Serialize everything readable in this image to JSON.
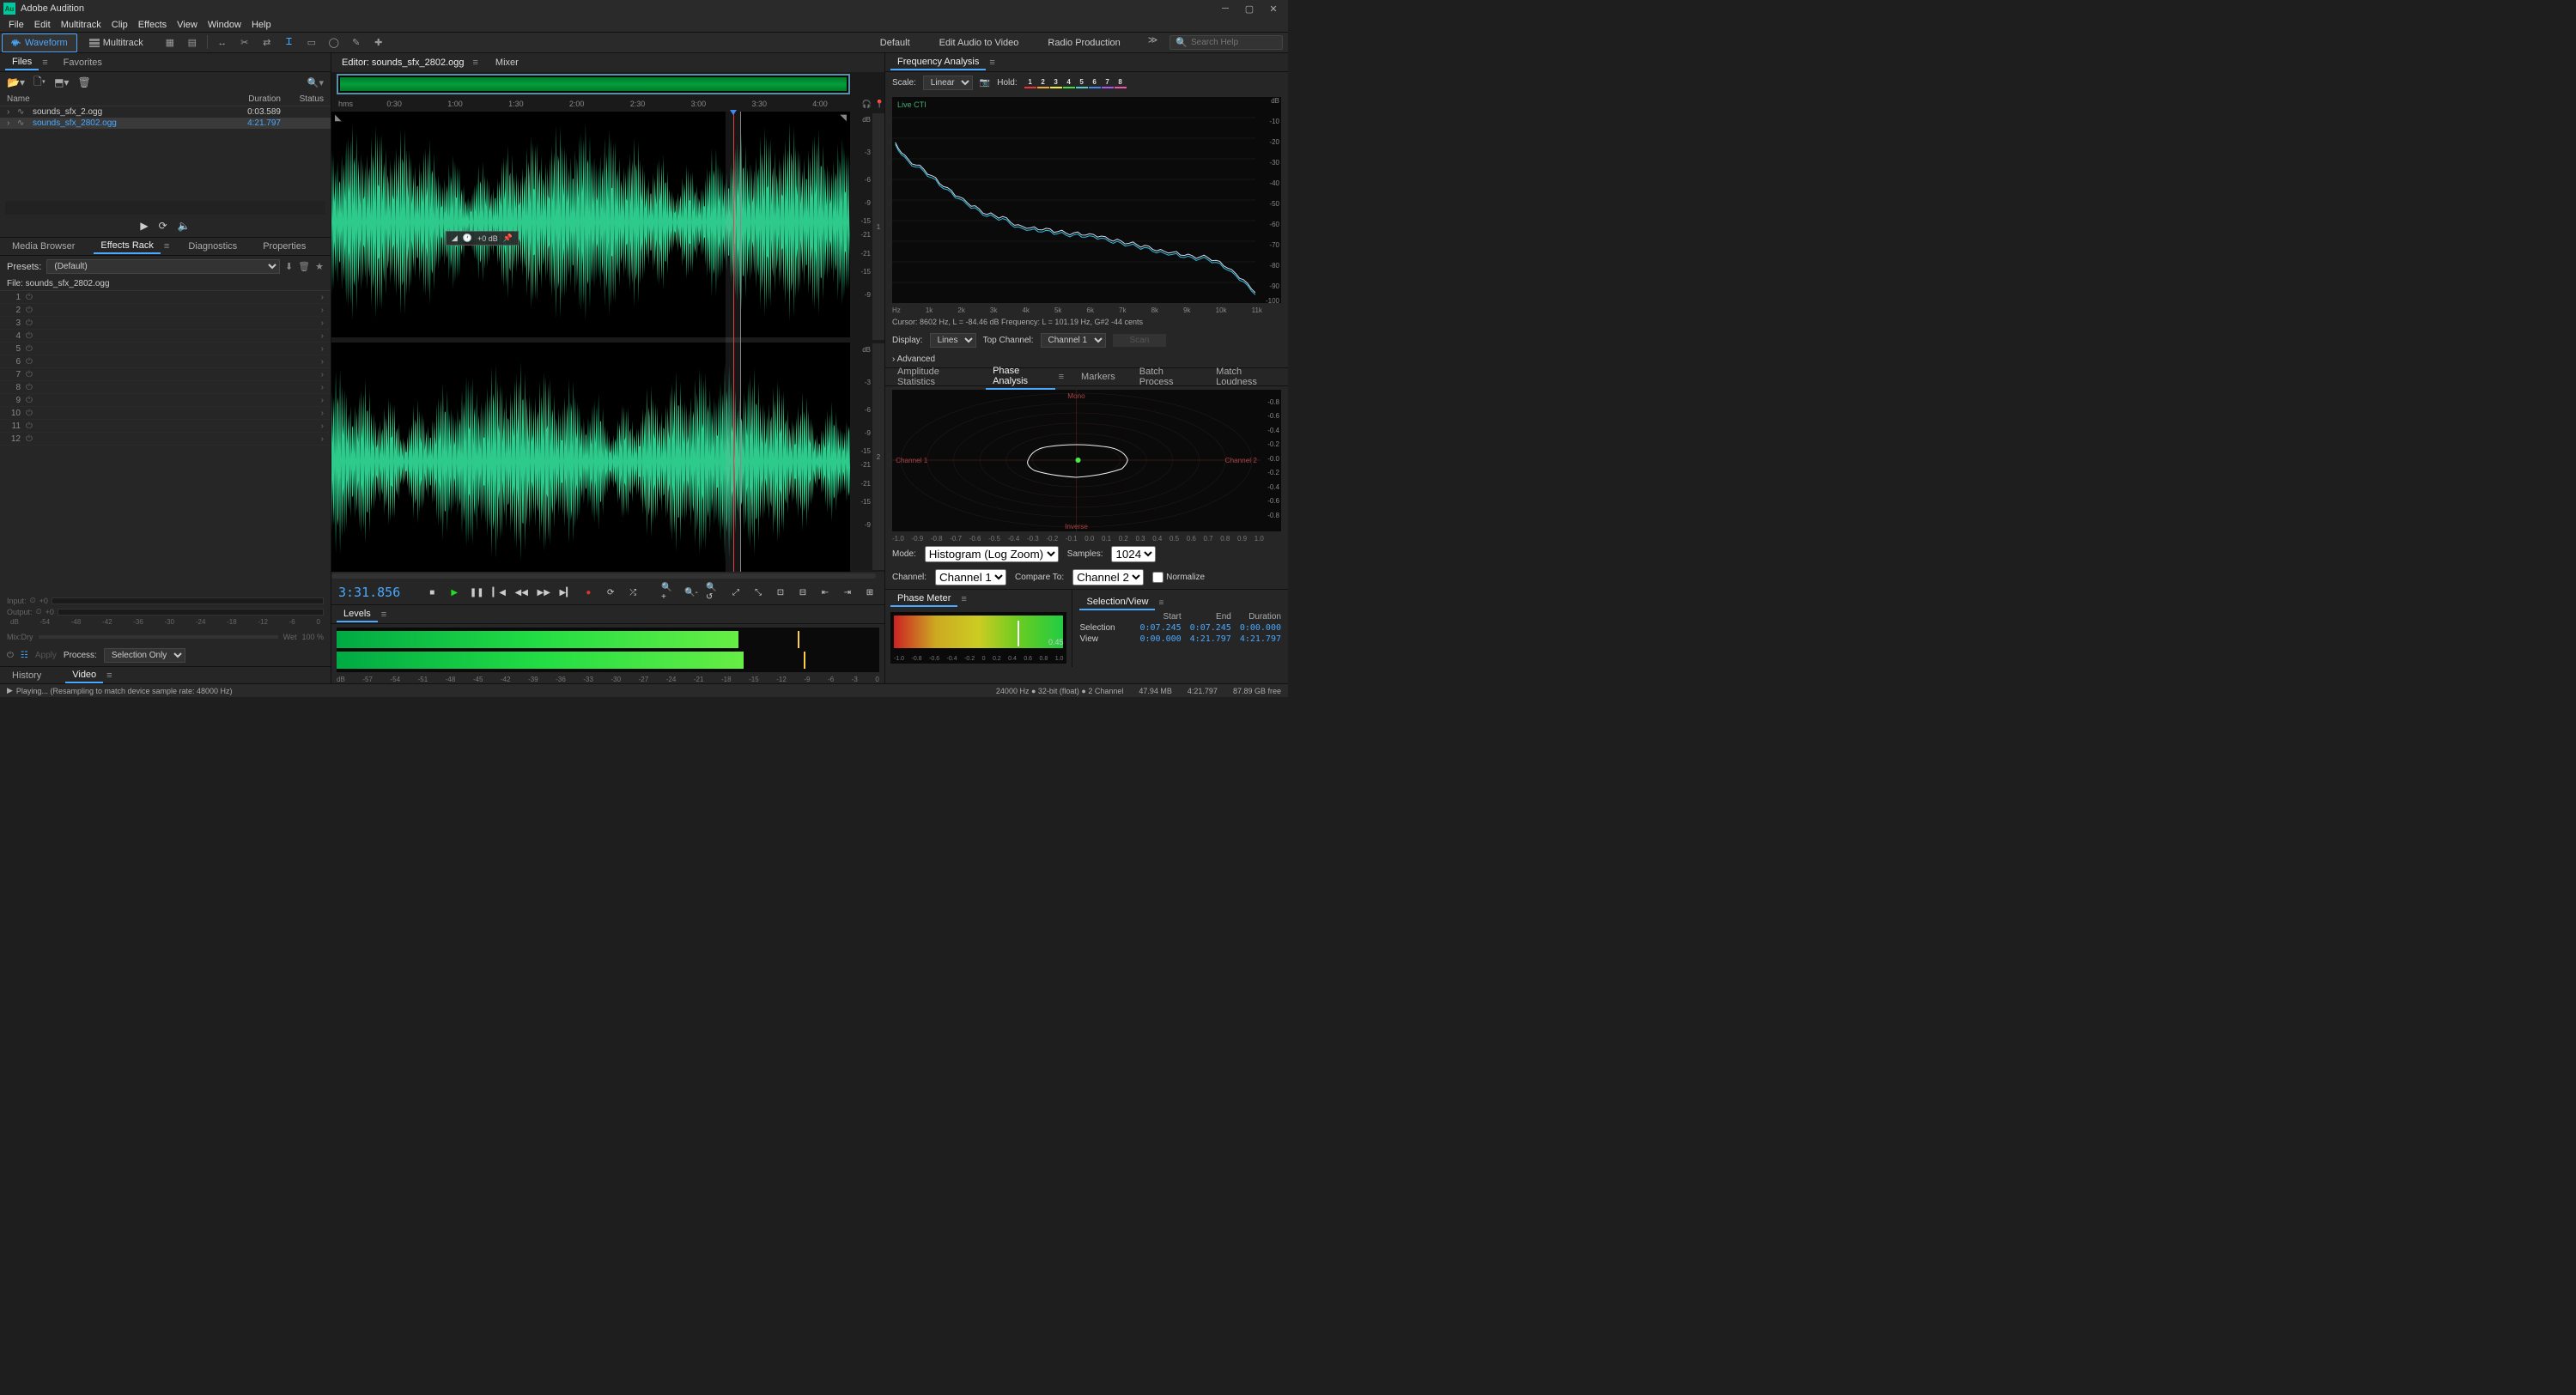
{
  "app": {
    "title": "Adobe Audition"
  },
  "menu": [
    "File",
    "Edit",
    "Multitrack",
    "Clip",
    "Effects",
    "View",
    "Window",
    "Help"
  ],
  "modes": {
    "waveform": "Waveform",
    "multitrack": "Multitrack"
  },
  "workspaces": [
    "Default",
    "Edit Audio to Video",
    "Radio Production"
  ],
  "search": {
    "placeholder": "Search Help"
  },
  "files_panel": {
    "tabs": [
      "Files",
      "Favorites"
    ],
    "columns": {
      "name": "Name",
      "duration": "Duration",
      "status": "Status"
    },
    "rows": [
      {
        "name": "sounds_sfx_2.ogg",
        "duration": "0:03.589",
        "selected": false
      },
      {
        "name": "sounds_sfx_2802.ogg",
        "duration": "4:21.797",
        "selected": true
      }
    ]
  },
  "effects_panel": {
    "tabs": [
      "Media Browser",
      "Effects Rack",
      "Diagnostics",
      "Properties"
    ],
    "presets_label": "Presets:",
    "preset_value": "(Default)",
    "file_label": "File: sounds_sfx_2802.ogg",
    "slots": [
      "1",
      "2",
      "3",
      "4",
      "5",
      "6",
      "7",
      "8",
      "9",
      "10",
      "11",
      "12"
    ],
    "input_label": "Input:",
    "output_label": "Output:",
    "io_val": "+0",
    "db_scale": [
      "dB",
      "-54",
      "-48",
      "-42",
      "-36",
      "-30",
      "-24",
      "-18",
      "-12",
      "-6",
      "0"
    ],
    "mix_label": "Mix:",
    "dry_label": "Dry",
    "wet_label": "Wet",
    "wet_pct": "100 %",
    "apply_label": "Apply",
    "process_label": "Process:",
    "process_value": "Selection Only"
  },
  "hv": {
    "tabs": [
      "History",
      "Video"
    ]
  },
  "editor": {
    "tab_label": "Editor: sounds_sfx_2802.ogg",
    "mixer_label": "Mixer",
    "ruler_label": "hms",
    "ticks": [
      "0:30",
      "1:00",
      "1:30",
      "2:00",
      "2:30",
      "3:00",
      "3:30",
      "4:00"
    ],
    "db_label": "dB",
    "db_ticks_ch": [
      "-3",
      "-6",
      "-9",
      "-15",
      "-21",
      "-21",
      "-15",
      "-9"
    ],
    "ch_badges": [
      "1",
      "2"
    ],
    "hud_db": "+0 dB",
    "timecode": "3:31.856"
  },
  "levels": {
    "title": "Levels",
    "scale": [
      "dB",
      "-57",
      "-54",
      "-51",
      "-48",
      "-45",
      "-42",
      "-39",
      "-36",
      "-33",
      "-30",
      "-27",
      "-24",
      "-21",
      "-18",
      "-15",
      "-12",
      "-9",
      "-6",
      "-3",
      "0"
    ]
  },
  "freq": {
    "title": "Frequency Analysis",
    "scale_label": "Scale:",
    "scale_value": "Linear",
    "hold_label": "Hold:",
    "channels": [
      "1",
      "2",
      "3",
      "4",
      "5",
      "6",
      "7",
      "8"
    ],
    "channel_colors": [
      "#e33",
      "#ea3",
      "#ee3",
      "#4d4",
      "#5cc",
      "#48e",
      "#a5e",
      "#e5a"
    ],
    "live_label": "Live CTI",
    "db_label": "dB",
    "db_ticks": [
      "-10",
      "-20",
      "-30",
      "-40",
      "-50",
      "-60",
      "-70",
      "-80",
      "-90",
      "-100"
    ],
    "hz_label": "Hz",
    "hz_ticks": [
      "Hz",
      "1k",
      "2k",
      "3k",
      "4k",
      "5k",
      "6k",
      "7k",
      "8k",
      "9k",
      "10k",
      "11k"
    ],
    "cursor_line": "Cursor: 8602 Hz, L = -84.46 dB    Frequency: L = 101.19 Hz, G#2 -44 cents",
    "display_label": "Display:",
    "display_value": "Lines",
    "topch_label": "Top Channel:",
    "topch_value": "Channel 1",
    "scan_label": "Scan",
    "advanced": "Advanced"
  },
  "phase": {
    "tabs": [
      "Amplitude Statistics",
      "Phase Analysis",
      "Markers",
      "Batch Process",
      "Match Loudness"
    ],
    "mono_label": "Mono",
    "inverse_label": "Inverse",
    "ch1_label": "Channel 1",
    "ch2_label": "Channel 2",
    "y_ticks": [
      "-0.8",
      "-0.6",
      "-0.4",
      "-0.2",
      "-0.0",
      "-0.2",
      "-0.4",
      "-0.6",
      "-0.8"
    ],
    "x_ticks": [
      "-1.0",
      "-0.9",
      "-0.8",
      "-0.7",
      "-0.6",
      "-0.5",
      "-0.4",
      "-0.3",
      "-0.2",
      "-0.1",
      "0.0",
      "0.1",
      "0.2",
      "0.3",
      "0.4",
      "0.5",
      "0.6",
      "0.7",
      "0.8",
      "0.9",
      "1.0"
    ],
    "mode_label": "Mode:",
    "mode_value": "Histogram (Log Zoom)",
    "samples_label": "Samples:",
    "samples_value": "1024",
    "channel_label": "Channel:",
    "channel_value": "Channel 1",
    "compare_label": "Compare To:",
    "compare_value": "Channel 2",
    "normalize": "Normalize"
  },
  "phase_meter": {
    "title": "Phase Meter",
    "value": "0.45",
    "scale": [
      "-1.0",
      "-0.8",
      "-0.6",
      "-0.4",
      "-0.2",
      "0",
      "0.2",
      "0.4",
      "0.6",
      "0.8",
      "1.0"
    ]
  },
  "selview": {
    "title": "Selection/View",
    "headers": [
      "Start",
      "End",
      "Duration"
    ],
    "rows": [
      {
        "label": "Selection",
        "start": "0:07.245",
        "end": "0:07.245",
        "dur": "0:00.000"
      },
      {
        "label": "View",
        "start": "0:00.000",
        "end": "4:21.797",
        "dur": "4:21.797"
      }
    ]
  },
  "status": {
    "left": "Playing... (Resampling to match device sample rate: 48000 Hz)",
    "items": [
      "24000 Hz ● 32-bit (float) ● 2 Channel",
      "47.94 MB",
      "4:21.797",
      "87.89 GB free"
    ]
  },
  "chart_data": [
    {
      "type": "line",
      "title": "Frequency Analysis",
      "xlabel": "Hz",
      "ylabel": "dB",
      "xlim": [
        0,
        11500
      ],
      "ylim": [
        -100,
        0
      ],
      "series": [
        {
          "name": "Channel 1",
          "color": "#cde",
          "x": [
            100,
            500,
            1000,
            1500,
            2000,
            2500,
            3000,
            3500,
            4000,
            4500,
            5000,
            5500,
            6000,
            6500,
            7000,
            7500,
            8000,
            8500,
            9000,
            9500,
            10000,
            10500,
            11000,
            11500
          ],
          "values": [
            -22,
            -30,
            -35,
            -42,
            -48,
            -53,
            -57,
            -58,
            -62,
            -63,
            -64,
            -66,
            -67,
            -68,
            -70,
            -71,
            -72,
            -74,
            -75,
            -77,
            -78,
            -82,
            -88,
            -95
          ]
        },
        {
          "name": "Channel 2",
          "color": "#3bd",
          "x": [
            100,
            500,
            1000,
            1500,
            2000,
            2500,
            3000,
            3500,
            4000,
            4500,
            5000,
            5500,
            6000,
            6500,
            7000,
            7500,
            8000,
            8500,
            9000,
            9500,
            10000,
            10500,
            11000,
            11500
          ],
          "values": [
            -23,
            -31,
            -36,
            -43,
            -49,
            -54,
            -58,
            -59,
            -63,
            -64,
            -65,
            -67,
            -68,
            -69,
            -71,
            -72,
            -73,
            -75,
            -76,
            -78,
            -79,
            -83,
            -89,
            -96
          ]
        }
      ]
    },
    {
      "type": "scatter",
      "title": "Phase Analysis (Lissajous)",
      "xlabel": "Channel 2",
      "ylabel": "Channel 1",
      "xlim": [
        -1,
        1
      ],
      "ylim": [
        -1,
        1
      ],
      "annotations": [
        "Mono",
        "Inverse",
        "Channel 1",
        "Channel 2"
      ],
      "centroid": [
        0.0,
        0.0
      ],
      "blob_extent": {
        "x": 0.28,
        "y": 0.1
      }
    },
    {
      "type": "bar",
      "title": "Phase Meter",
      "xlim": [
        -1,
        1
      ],
      "values": [
        0.45
      ]
    },
    {
      "type": "bar",
      "title": "Levels",
      "xlabel": "dB",
      "xlim": [
        -57,
        0
      ],
      "series": [
        {
          "name": "L",
          "values": [
            -12.0
          ],
          "peak": -6.5
        },
        {
          "name": "R",
          "values": [
            -11.5
          ],
          "peak": -6.0
        }
      ]
    }
  ]
}
